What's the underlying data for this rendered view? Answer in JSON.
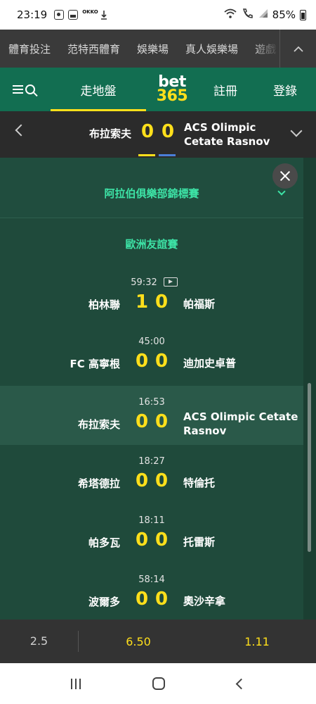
{
  "status_bar": {
    "time": "23:19",
    "left_icons": [
      "record-icon",
      "gallery-icon",
      "okko-icon",
      "download-icon"
    ],
    "okko_text": "OKKO",
    "right_icons": [
      "wifi-icon",
      "call-icon",
      "signal-icon"
    ],
    "battery": "85%"
  },
  "top_nav": {
    "items": [
      "體育投注",
      "范特西體育",
      "娛樂場",
      "真人娛樂場",
      "遊戲"
    ],
    "more_icon": "chevron-up-icon"
  },
  "header": {
    "in_play": "走地盤",
    "logo_top": "bet",
    "logo_bottom": "365",
    "register": "註冊",
    "login": "登錄",
    "colors": {
      "green": "#126e51",
      "yellow": "#ffdf1b"
    }
  },
  "match_header": {
    "home": "布拉索夫",
    "home_score": "0",
    "away_score": "0",
    "away_line1": "ACS Olimpic",
    "away_line2": "Cetate Rasnov",
    "home_color": "#ffdf1b",
    "away_color": "#4a7ed8"
  },
  "competition": {
    "title": "阿拉伯俱樂部錦標賽",
    "group": "歐洲友誼賽",
    "matches": [
      {
        "clock": "59:32",
        "video": true,
        "home": "柏林聯",
        "hs": "1",
        "as": "0",
        "away": "帕福斯",
        "away2": ""
      },
      {
        "clock": "45:00",
        "video": false,
        "home": "FC 高寧根",
        "hs": "0",
        "as": "0",
        "away": "迪加史卓普",
        "away2": ""
      },
      {
        "clock": "16:53",
        "video": false,
        "home": "布拉索夫",
        "hs": "0",
        "as": "0",
        "away": "ACS Olimpic Cetate",
        "away2": "Rasnov"
      },
      {
        "clock": "18:27",
        "video": false,
        "home": "希塔德拉",
        "hs": "0",
        "as": "0",
        "away": "特倫托",
        "away2": ""
      },
      {
        "clock": "18:11",
        "video": false,
        "home": "帕多瓦",
        "hs": "0",
        "as": "0",
        "away": "托雷斯",
        "away2": ""
      },
      {
        "clock": "58:14",
        "video": false,
        "home": "波爾多",
        "hs": "0",
        "as": "0",
        "away": "奧沙辛拿",
        "away2": ""
      }
    ]
  },
  "bet_bar": {
    "odds1": "2.5",
    "odds2": "6.50",
    "odds3": "1.11"
  }
}
